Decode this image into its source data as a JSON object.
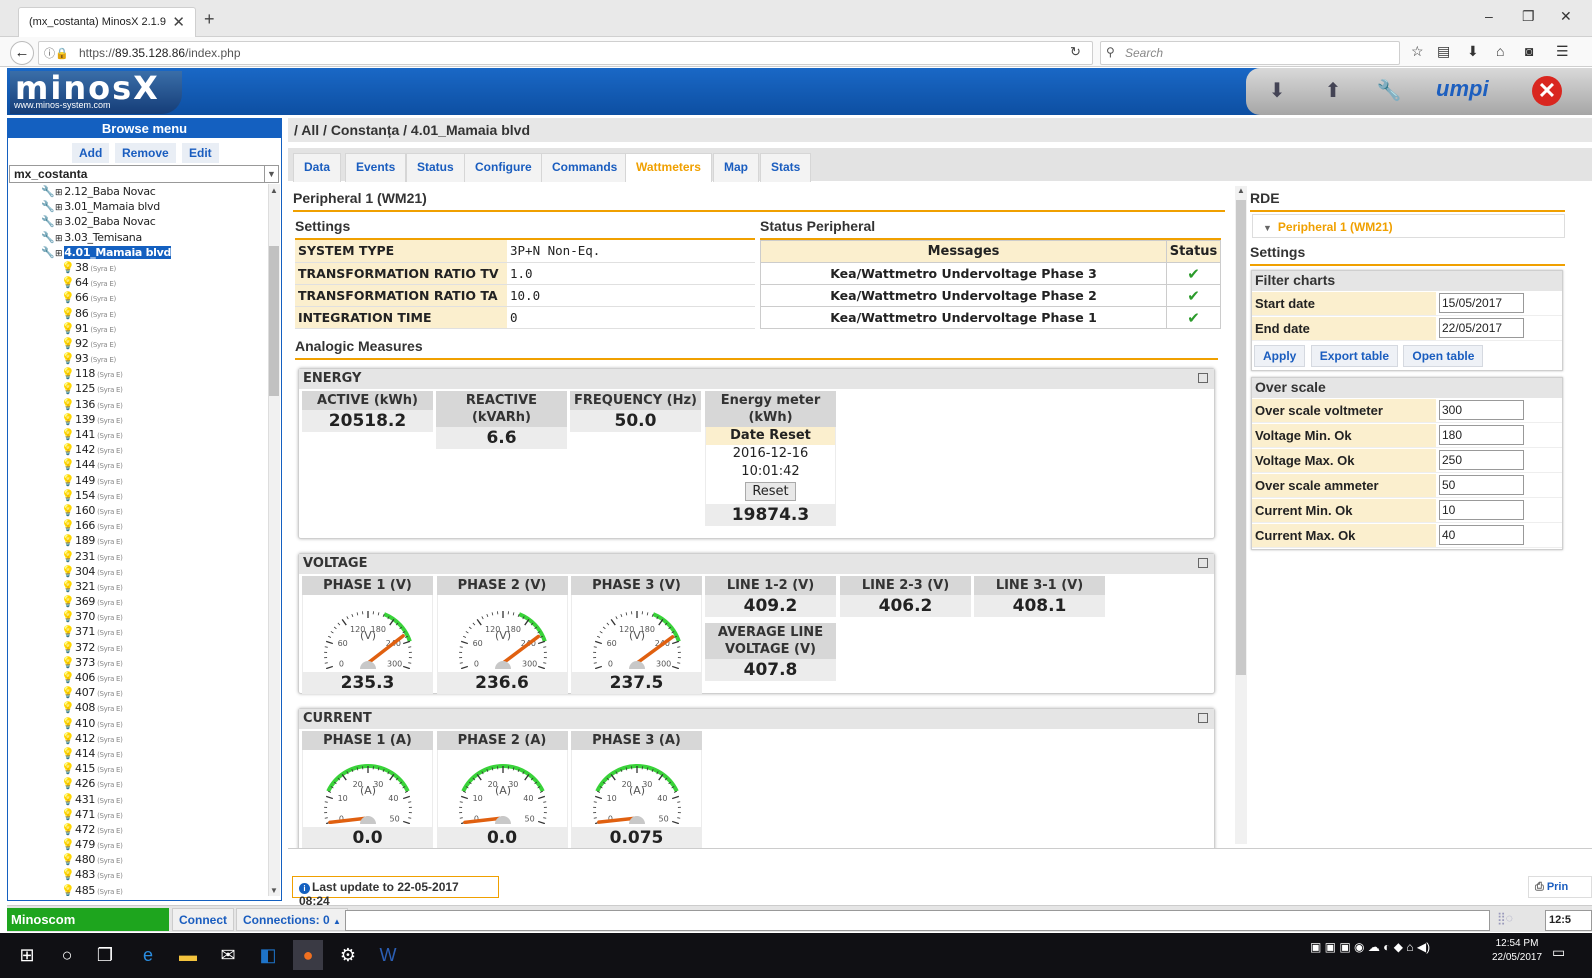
{
  "browser": {
    "tab_title": "(mx_costanta) MinosX 2.1.9",
    "url_prefix": "https://",
    "url_host": "89.35.128.86",
    "url_path": "/index.php",
    "search_placeholder": "Search"
  },
  "header": {
    "logo": "minosX",
    "logo_sub": "www.minos-system.com",
    "brand": "umpi"
  },
  "sidebar": {
    "title": "Browse menu",
    "buttons": [
      "Add",
      "Remove",
      "Edit"
    ],
    "selected_site": "mx_costanta",
    "groups": [
      {
        "label": "2.12_Baba Novac"
      },
      {
        "label": "3.01_Mamaia blvd"
      },
      {
        "label": "3.02_Baba Novac"
      },
      {
        "label": "3.03_Temisana"
      },
      {
        "label": "4.01_Mamaia blvd",
        "selected": true
      }
    ],
    "device_suffix": "(Syra E)",
    "devices": [
      "38",
      "64",
      "66",
      "86",
      "91",
      "92",
      "93",
      "118",
      "125",
      "136",
      "139",
      "141",
      "142",
      "144",
      "149",
      "154",
      "160",
      "166",
      "189",
      "231",
      "304",
      "321",
      "369",
      "370",
      "371",
      "372",
      "373",
      "406",
      "407",
      "408",
      "410",
      "412",
      "414",
      "415",
      "426",
      "431",
      "471",
      "472",
      "479",
      "480",
      "483",
      "485"
    ]
  },
  "breadcrumb": "/ All / Constanța / 4.01_Mamaia blvd",
  "tabs": [
    "Data",
    "Events",
    "Status",
    "Configure",
    "Commands",
    "Wattmeters",
    "Map",
    "Stats"
  ],
  "active_tab": "Wattmeters",
  "peripheral_title": "Peripheral 1 (WM21)",
  "settings": {
    "title": "Settings",
    "rows": [
      {
        "k": "SYSTEM TYPE",
        "v": "3P+N Non-Eq."
      },
      {
        "k": "TRANSFORMATION RATIO TV",
        "v": "1.0"
      },
      {
        "k": "TRANSFORMATION RATIO TA",
        "v": "10.0"
      },
      {
        "k": "INTEGRATION TIME",
        "v": "0"
      }
    ]
  },
  "status_peripheral": {
    "title": "Status Peripheral",
    "col_messages": "Messages",
    "col_status": "Status",
    "rows": [
      {
        "msg": "Kea/Wattmetro Undervoltage Phase 3",
        "status": "✔"
      },
      {
        "msg": "Kea/Wattmetro Undervoltage Phase 2",
        "status": "✔"
      },
      {
        "msg": "Kea/Wattmetro Undervoltage Phase 1",
        "status": "✔"
      }
    ]
  },
  "analogic_title": "Analogic Measures",
  "energy": {
    "title": "ENERGY",
    "active": {
      "label": "ACTIVE (kWh)",
      "value": "20518.2"
    },
    "reactive": {
      "label": "REACTIVE (kVARh)",
      "value": "6.6"
    },
    "frequency": {
      "label": "FREQUENCY (Hz)",
      "value": "50.0"
    },
    "meter": {
      "label": "Energy meter (kWh)",
      "date_reset_label": "Date Reset",
      "date": "2016-12-16",
      "time": "10:01:42",
      "reset_btn": "Reset",
      "value": "19874.3"
    }
  },
  "voltage": {
    "title": "VOLTAGE",
    "unit": "(V)",
    "scale": [
      "0",
      "60",
      "120",
      "180",
      "240",
      "300"
    ],
    "phases": [
      {
        "label": "PHASE 1 (V)",
        "value": "235.3",
        "level": 235.3
      },
      {
        "label": "PHASE 2 (V)",
        "value": "236.6",
        "level": 236.6
      },
      {
        "label": "PHASE 3 (V)",
        "value": "237.5",
        "level": 237.5
      }
    ],
    "lines": [
      {
        "label": "LINE 1-2 (V)",
        "value": "409.2"
      },
      {
        "label": "LINE 2-3 (V)",
        "value": "406.2"
      },
      {
        "label": "LINE 3-1 (V)",
        "value": "408.1"
      }
    ],
    "average": {
      "label": "AVERAGE LINE VOLTAGE (V)",
      "value": "407.8"
    }
  },
  "current": {
    "title": "CURRENT",
    "unit": "(A)",
    "scale": [
      "0",
      "10",
      "20",
      "30",
      "40",
      "50"
    ],
    "phases": [
      {
        "label": "PHASE 1 (A)",
        "value": "0.0",
        "level": 0
      },
      {
        "label": "PHASE 2 (A)",
        "value": "0.0",
        "level": 0
      },
      {
        "label": "PHASE 3 (A)",
        "value": "0.075",
        "level": 0.075
      }
    ]
  },
  "rde": {
    "title": "RDE",
    "item": "Peripheral 1 (WM21)",
    "settings_title": "Settings",
    "filter": {
      "title": "Filter charts",
      "start_label": "Start date",
      "start_value": "15/05/2017",
      "end_label": "End date",
      "end_value": "22/05/2017",
      "buttons": [
        "Apply",
        "Export table",
        "Open table"
      ]
    },
    "overscale": {
      "title": "Over scale",
      "rows": [
        {
          "k": "Over scale voltmeter",
          "v": "300"
        },
        {
          "k": "Voltage Min. Ok",
          "v": "180"
        },
        {
          "k": "Voltage Max. Ok",
          "v": "250"
        },
        {
          "k": "Over scale ammeter",
          "v": "50"
        },
        {
          "k": "Current Min. Ok",
          "v": "10"
        },
        {
          "k": "Current Max. Ok",
          "v": "40"
        }
      ]
    }
  },
  "footer": {
    "last_update": "Last update to 22-05-2017 08:24",
    "print": "Prin",
    "minoscom": "Minoscom",
    "connect": "Connect",
    "connections": "Connections: 0",
    "clock_partial": "12:5"
  },
  "taskbar": {
    "time": "12:54 PM",
    "date": "22/05/2017"
  },
  "colors": {
    "accent": "#f0a000",
    "link": "#1a5dbf",
    "header_blue": "#1460c0",
    "ok_green": "#2b9b2b",
    "needle": "#e06010"
  }
}
